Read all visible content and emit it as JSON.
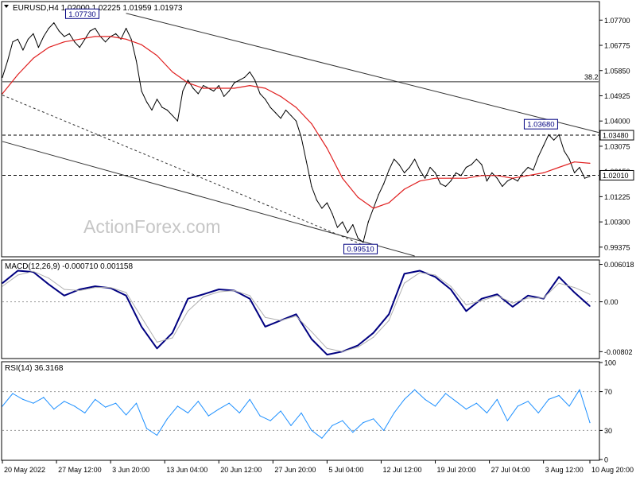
{
  "chart_data": {
    "type": "line",
    "panels": {
      "price": {
        "header": "EURUSD,H4  1.02000 1.02225 1.01959 1.01973",
        "ylim": [
          0.9905,
          1.0835
        ],
        "ticks": [
          "1.07700",
          "1.06775",
          "1.05850",
          "1.04925",
          "1.04000",
          "1.03075",
          "1.02150",
          "1.01225",
          "1.00300",
          "0.99375"
        ],
        "tick_values": [
          1.077,
          1.06775,
          1.0585,
          1.04925,
          1.04,
          1.03075,
          1.0215,
          1.01225,
          1.003,
          0.99375
        ],
        "watermark": "ActionForex.com",
        "fib_label": "38.2",
        "fib_level": 1.0544,
        "levels": [
          {
            "value": 1.0348,
            "label": "1.03480",
            "style": "dashed"
          },
          {
            "value": 1.0201,
            "label": "1.02010",
            "style": "dashed"
          }
        ],
        "callouts": [
          {
            "label": "1.07730",
            "value": 1.0773,
            "x": 15.5
          },
          {
            "label": "1.03680",
            "value": 1.0368,
            "x": 104.5
          },
          {
            "label": "0.99510",
            "value": 0.9951,
            "x": 69.5
          }
        ],
        "trendlines": [
          {
            "x1": 24,
            "y1": 1.0795,
            "x2": 115,
            "y2": 1.0358,
            "style": "solid"
          },
          {
            "x1": 0,
            "y1": 1.0325,
            "x2": 80,
            "y2": 0.9905,
            "style": "solid"
          },
          {
            "x1": 0,
            "y1": 1.0495,
            "x2": 70,
            "y2": 0.9945,
            "style": "dotted"
          }
        ],
        "series": [
          {
            "name": "price",
            "color": "#000000",
            "x": [
              0,
              1,
              2,
              3,
              4,
              5,
              6,
              7,
              8,
              9,
              10,
              11,
              12,
              13,
              14,
              15,
              16,
              17,
              18,
              19,
              20,
              21,
              22,
              23,
              24,
              25,
              26,
              27,
              28,
              29,
              30,
              31,
              32,
              33,
              34,
              35,
              36,
              37,
              38,
              39,
              40,
              41,
              42,
              43,
              44,
              45,
              46,
              47,
              48,
              49,
              50,
              51,
              52,
              53,
              54,
              55,
              56,
              57,
              58,
              59,
              60,
              61,
              62,
              63,
              64,
              65,
              66,
              67,
              68,
              69,
              70,
              71,
              72,
              73,
              74,
              75,
              76,
              77,
              78,
              79,
              80,
              81,
              82,
              83,
              84,
              85,
              86,
              87,
              88,
              89,
              90,
              91,
              92,
              93,
              94,
              95,
              96,
              97,
              98,
              99,
              100,
              101,
              102,
              103,
              104,
              105,
              106,
              107,
              108,
              109,
              110,
              111,
              112,
              113,
              114
            ],
            "y": [
              1.056,
              1.062,
              1.069,
              1.07,
              1.066,
              1.07,
              1.072,
              1.067,
              1.071,
              1.074,
              1.076,
              1.073,
              1.071,
              1.072,
              1.069,
              1.067,
              1.07,
              1.073,
              1.074,
              1.071,
              1.069,
              1.071,
              1.072,
              1.07,
              1.074,
              1.07,
              1.062,
              1.051,
              1.047,
              1.044,
              1.048,
              1.045,
              1.044,
              1.042,
              1.04,
              1.051,
              1.055,
              1.052,
              1.05,
              1.053,
              1.052,
              1.051,
              1.053,
              1.049,
              1.051,
              1.054,
              1.055,
              1.056,
              1.058,
              1.055,
              1.05,
              1.048,
              1.045,
              1.043,
              1.041,
              1.044,
              1.042,
              1.04,
              1.034,
              1.025,
              1.016,
              1.011,
              1.008,
              1.01,
              1.006,
              1.001,
              1.003,
              0.999,
              1.002,
              0.997,
              0.9955,
              1.003,
              1.008,
              1.013,
              1.017,
              1.022,
              1.026,
              1.024,
              1.021,
              1.023,
              1.026,
              1.022,
              1.019,
              1.023,
              1.021,
              1.017,
              1.016,
              1.018,
              1.021,
              1.02,
              1.023,
              1.024,
              1.026,
              1.024,
              1.018,
              1.021,
              1.019,
              1.016,
              1.018,
              1.019,
              1.018,
              1.021,
              1.023,
              1.022,
              1.027,
              1.031,
              1.035,
              1.033,
              1.035,
              1.029,
              1.026,
              1.021,
              1.023,
              1.019,
              1.0197
            ]
          },
          {
            "name": "ma",
            "color": "#e02020",
            "x": [
              0,
              3,
              6,
              9,
              12,
              15,
              18,
              21,
              24,
              27,
              30,
              33,
              36,
              39,
              42,
              45,
              48,
              51,
              54,
              57,
              60,
              63,
              66,
              69,
              72,
              75,
              78,
              81,
              84,
              87,
              90,
              93,
              96,
              99,
              102,
              105,
              108,
              111,
              114
            ],
            "y": [
              1.05,
              1.057,
              1.063,
              1.067,
              1.069,
              1.07,
              1.071,
              1.071,
              1.07,
              1.068,
              1.064,
              1.058,
              1.054,
              1.052,
              1.052,
              1.052,
              1.053,
              1.052,
              1.049,
              1.045,
              1.039,
              1.03,
              1.019,
              1.012,
              1.008,
              1.01,
              1.015,
              1.018,
              1.019,
              1.019,
              1.019,
              1.02,
              1.02,
              1.019,
              1.02,
              1.021,
              1.023,
              1.025,
              1.0245
            ]
          }
        ]
      },
      "macd": {
        "header": "MACD(12,26,9) -0.000710 0.001158",
        "ylim": [
          -0.009,
          0.0066
        ],
        "ticks": [
          "0.006018",
          "0.00",
          "-0.00802"
        ],
        "tick_values": [
          0.006018,
          0.0,
          -0.00802
        ],
        "series": [
          {
            "name": "macd",
            "color": "#000080",
            "x": [
              0,
              3,
              6,
              9,
              12,
              15,
              18,
              21,
              24,
              27,
              30,
              33,
              36,
              39,
              42,
              45,
              48,
              51,
              54,
              57,
              60,
              63,
              66,
              69,
              72,
              75,
              78,
              81,
              84,
              87,
              90,
              93,
              96,
              99,
              102,
              105,
              108,
              111,
              114
            ],
            "y": [
              0.003,
              0.005,
              0.0048,
              0.0028,
              0.001,
              0.002,
              0.0025,
              0.0022,
              0.001,
              -0.004,
              -0.0075,
              -0.005,
              0.0005,
              0.0012,
              0.002,
              0.0018,
              0.0005,
              -0.004,
              -0.003,
              -0.002,
              -0.006,
              -0.0085,
              -0.008,
              -0.007,
              -0.005,
              -0.002,
              0.0045,
              0.005,
              0.004,
              0.002,
              -0.0015,
              0.0005,
              0.0012,
              -0.0008,
              0.001,
              0.0005,
              0.004,
              0.0015,
              -0.0007
            ]
          },
          {
            "name": "signal",
            "color": "#b0b0b0",
            "x": [
              0,
              3,
              6,
              9,
              12,
              15,
              18,
              21,
              24,
              27,
              30,
              33,
              36,
              39,
              42,
              45,
              48,
              51,
              54,
              57,
              60,
              63,
              66,
              69,
              72,
              75,
              78,
              81,
              84,
              87,
              90,
              93,
              96,
              99,
              102,
              105,
              108,
              111,
              114
            ],
            "y": [
              0.0025,
              0.0043,
              0.0049,
              0.0038,
              0.002,
              0.0018,
              0.0023,
              0.0023,
              0.0015,
              -0.0025,
              -0.0065,
              -0.0058,
              -0.0015,
              0.0008,
              0.0016,
              0.0018,
              0.001,
              -0.0025,
              -0.003,
              -0.0023,
              -0.0048,
              -0.0075,
              -0.008,
              -0.0073,
              -0.0057,
              -0.003,
              0.003,
              0.0047,
              0.0043,
              0.0025,
              -0.0005,
              0.0002,
              0.001,
              -0.0002,
              0.0006,
              0.0006,
              0.003,
              0.0023,
              0.0012
            ]
          }
        ]
      },
      "rsi": {
        "header": "RSI(14) 36.3168",
        "ylim": [
          0,
          100
        ],
        "ticks": [
          "100",
          "70",
          "30",
          "0"
        ],
        "tick_values": [
          100,
          70,
          30,
          0
        ],
        "series": [
          {
            "name": "rsi",
            "color": "#1e90ff",
            "x": [
              0,
              2,
              4,
              6,
              8,
              10,
              12,
              14,
              16,
              18,
              20,
              22,
              24,
              26,
              28,
              30,
              32,
              34,
              36,
              38,
              40,
              42,
              44,
              46,
              48,
              50,
              52,
              54,
              56,
              58,
              60,
              62,
              64,
              66,
              68,
              70,
              72,
              74,
              76,
              78,
              80,
              82,
              84,
              86,
              88,
              90,
              92,
              94,
              96,
              98,
              100,
              102,
              104,
              106,
              108,
              110,
              112,
              114
            ],
            "y": [
              55,
              68,
              62,
              58,
              64,
              52,
              60,
              55,
              48,
              62,
              54,
              58,
              46,
              58,
              32,
              25,
              42,
              55,
              48,
              60,
              45,
              52,
              58,
              48,
              62,
              45,
              40,
              50,
              35,
              48,
              30,
              22,
              35,
              40,
              28,
              38,
              42,
              30,
              48,
              62,
              72,
              62,
              55,
              68,
              60,
              52,
              58,
              48,
              62,
              40,
              55,
              60,
              48,
              62,
              66,
              55,
              72,
              38
            ]
          }
        ]
      }
    },
    "x_ticks": [
      "20 May 2022",
      "27 May 12:00",
      "3 Jun 20:00",
      "13 Jun 04:00",
      "20 Jun 12:00",
      "27 Jun 20:00",
      "5 Jul 04:00",
      "12 Jul 12:00",
      "19 Jul 20:00",
      "27 Jul 04:00",
      "3 Aug 12:00",
      "10 Aug 20:00"
    ],
    "x_tick_positions": [
      0,
      10.5,
      21,
      31.5,
      42,
      52.5,
      63,
      73.5,
      84,
      94.5,
      105,
      114
    ],
    "x_range": [
      0,
      114
    ]
  }
}
